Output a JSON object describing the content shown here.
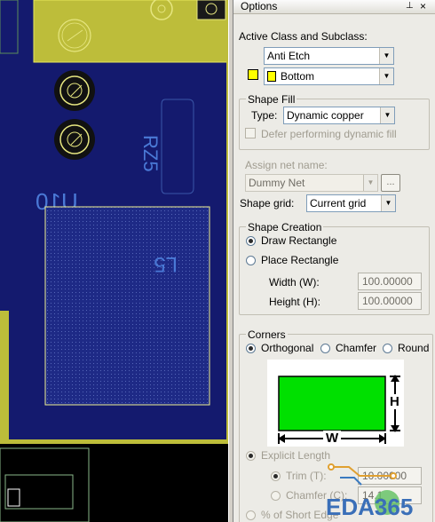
{
  "canvas": {
    "silk_labels": [
      "RZ5",
      "U10",
      "L5"
    ]
  },
  "panel": {
    "title": "Options",
    "pin_glyph": "⊥",
    "close_glyph": "×",
    "class_label": "Active Class and Subclass:",
    "class_value": "Anti Etch",
    "subclass_value": "Bottom",
    "subclass_color": "#ffff00",
    "shape_fill": {
      "legend": "Shape Fill",
      "type_label": "Type:",
      "type_value": "Dynamic copper",
      "defer_label": "Defer performing dynamic fill"
    },
    "assign_net_label": "Assign net name:",
    "net_value": "Dummy Net",
    "browse_label": "...",
    "shape_grid_label": "Shape grid:",
    "shape_grid_value": "Current grid",
    "creation": {
      "legend": "Shape Creation",
      "draw_label": "Draw Rectangle",
      "place_label": "Place Rectangle",
      "width_label": "Width (W):",
      "width_value": "100.00000",
      "height_label": "Height (H):",
      "height_value": "100.00000"
    },
    "corners": {
      "legend": "Corners",
      "orthogonal_label": "Orthogonal",
      "chamfer_label": "Chamfer",
      "round_label": "Round",
      "diagram_h": "H",
      "diagram_w": "W",
      "explicit_label": "Explicit Length",
      "trim_label": "Trim (T):",
      "trim_value": "10.00000",
      "chamfer_c_label": "Chamfer (C):",
      "chamfer_c_value": "14.1",
      "short_edge_label": "% of Short Edge"
    },
    "watermark": "EDA365"
  }
}
